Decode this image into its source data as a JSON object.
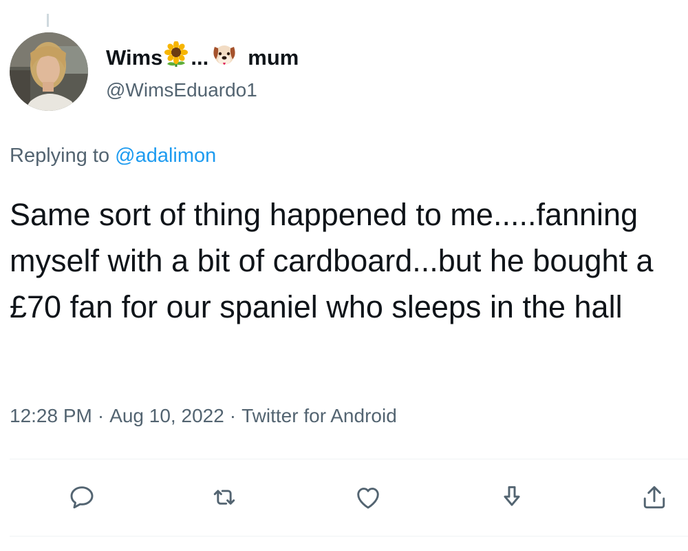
{
  "author": {
    "name_prefix": "Wims",
    "name_dots": "...",
    "name_suffix": "mum",
    "name_emojis": [
      "sunflower-emoji",
      "dog-face-emoji"
    ],
    "handle": "@WimsEduardo1"
  },
  "reply": {
    "prefix": "Replying to",
    "mention": "@adalimon"
  },
  "tweet": {
    "text": "Same sort of thing happened to me.....fanning myself with a bit of cardboard...but he bought a £70 fan for our spaniel who sleeps in the hall"
  },
  "meta": {
    "time": "12:28 PM",
    "separator": "·",
    "date": "Aug 10, 2022",
    "source": "Twitter for Android"
  },
  "actions": [
    {
      "name": "reply",
      "icon": "speech-bubble-icon"
    },
    {
      "name": "retweet",
      "icon": "retweet-arrows-icon"
    },
    {
      "name": "like",
      "icon": "heart-icon"
    },
    {
      "name": "bookmark",
      "icon": "download-arrow-icon"
    },
    {
      "name": "share",
      "icon": "share-upload-icon"
    }
  ],
  "colors": {
    "text_primary": "#0f1419",
    "text_secondary": "#536471",
    "link": "#1d9bf0",
    "divider": "#eff3f4"
  }
}
